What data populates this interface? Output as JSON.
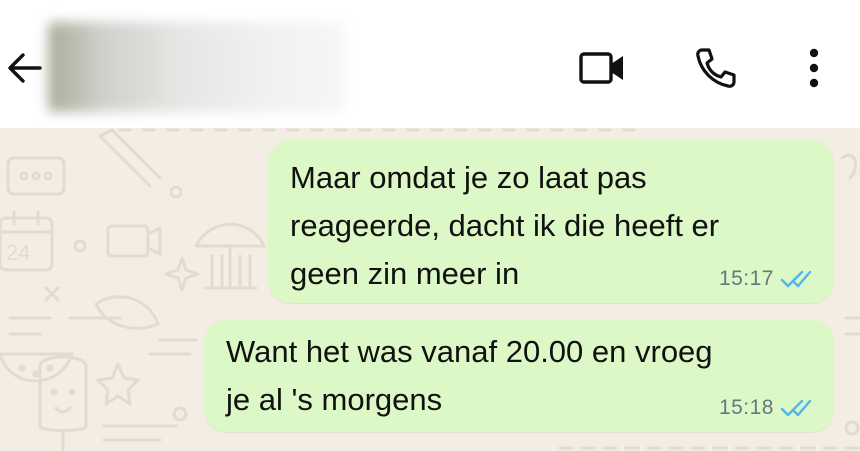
{
  "header": {
    "contact_name": "",
    "icons": [
      "back-arrow-icon",
      "video-call-icon",
      "phone-icon",
      "more-vertical-icon"
    ]
  },
  "colors": {
    "header_bg": "#ffffff",
    "chat_bg": "#f3ede3",
    "outgoing_bubble": "#dcf8c6",
    "read_ticks": "#4fb6ec",
    "time_text": "#667781"
  },
  "messages": [
    {
      "direction": "outgoing",
      "text": "Maar omdat je zo laat pas\nreageerde, dacht ik die heeft er\ngeen zin meer in",
      "time": "15:17",
      "status": "read"
    },
    {
      "direction": "outgoing",
      "text": "Want het was vanaf 20.00 en vroeg\nje al 's morgens",
      "time": "15:18",
      "status": "read"
    }
  ]
}
